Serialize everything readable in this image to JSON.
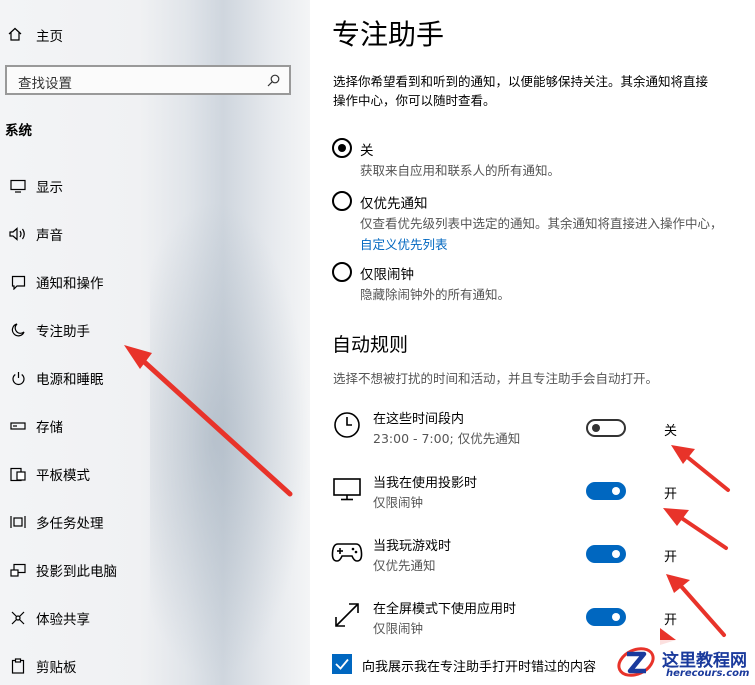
{
  "sidebar": {
    "home_label": "主页",
    "search_placeholder": "查找设置",
    "section_title": "系统",
    "items": [
      {
        "label": "显示",
        "icon": "monitor-icon"
      },
      {
        "label": "声音",
        "icon": "speaker-icon"
      },
      {
        "label": "通知和操作",
        "icon": "notification-icon"
      },
      {
        "label": "专注助手",
        "icon": "moon-icon"
      },
      {
        "label": "电源和睡眠",
        "icon": "power-icon"
      },
      {
        "label": "存储",
        "icon": "storage-icon"
      },
      {
        "label": "平板模式",
        "icon": "tablet-mode-icon"
      },
      {
        "label": "多任务处理",
        "icon": "multitask-icon"
      },
      {
        "label": "投影到此电脑",
        "icon": "project-icon"
      },
      {
        "label": "体验共享",
        "icon": "share-icon"
      },
      {
        "label": "剪贴板",
        "icon": "clipboard-icon"
      }
    ]
  },
  "main": {
    "title": "专注助手",
    "description_line1": "选择你希望看到和听到的通知，以便能够保持关注。其余通知将直接",
    "description_line2": "操作中心，你可以随时查看。",
    "options": [
      {
        "label": "关",
        "desc": "获取来自应用和联系人的所有通知。",
        "selected": true
      },
      {
        "label": "仅优先通知",
        "desc": "仅查看优先级列表中选定的通知。其余通知将直接进入操作中心，",
        "link": "自定义优先列表",
        "selected": false
      },
      {
        "label": "仅限闹钟",
        "desc": "隐藏除闹钟外的所有通知。",
        "selected": false
      }
    ],
    "auto_rules_title": "自动规则",
    "auto_rules_desc": "选择不想被打扰的时间和活动，并且专注助手会自动打开。",
    "rules": [
      {
        "title": "在这些时间段内",
        "subtitle": "23:00 - 7:00; 仅优先通知",
        "state_label": "关",
        "on": false,
        "icon": "clock-icon"
      },
      {
        "title": "当我在使用投影时",
        "subtitle": "仅限闹钟",
        "state_label": "开",
        "on": true,
        "icon": "display-icon"
      },
      {
        "title": "当我玩游戏时",
        "subtitle": "仅优先通知",
        "state_label": "开",
        "on": true,
        "icon": "gamepad-icon"
      },
      {
        "title": "在全屏模式下使用应用时",
        "subtitle": "仅限闹钟",
        "state_label": "开",
        "on": true,
        "icon": "fullscreen-icon"
      }
    ],
    "checkbox_label": "向我展示我在专注助手打开时错过的内容",
    "checkbox_checked": true
  },
  "watermark": {
    "title": "这里教程网",
    "url": "herecours.com"
  },
  "colors": {
    "accent": "#0067c0",
    "arrow": "#e8332a"
  }
}
